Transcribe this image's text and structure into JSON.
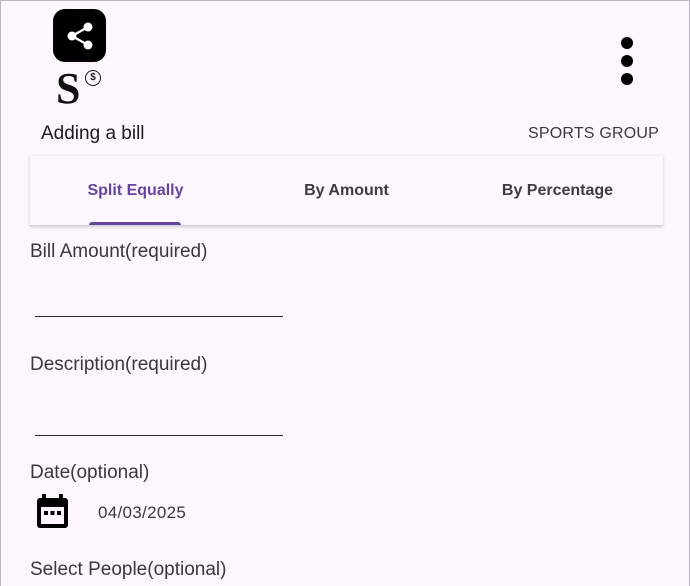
{
  "header": {
    "app_icon": "share-icon",
    "logo_letter": "S",
    "logo_badge": "$",
    "menu_icon": "more-vert-icon"
  },
  "page": {
    "title": "Adding a bill",
    "group": "SPORTS GROUP"
  },
  "tabs": [
    {
      "label": "Split Equally",
      "active": true
    },
    {
      "label": "By Amount",
      "active": false
    },
    {
      "label": "By Percentage",
      "active": false
    }
  ],
  "form": {
    "bill_amount_label": "Bill Amount(required)",
    "bill_amount_value": "",
    "description_label": "Description(required)",
    "description_value": "",
    "date_label": "Date(optional)",
    "date_value": "04/03/2025",
    "date_icon": "calendar-icon",
    "people_label": "Select People(optional)"
  },
  "colors": {
    "accent": "#65459c",
    "background": "#fdf6fe"
  }
}
